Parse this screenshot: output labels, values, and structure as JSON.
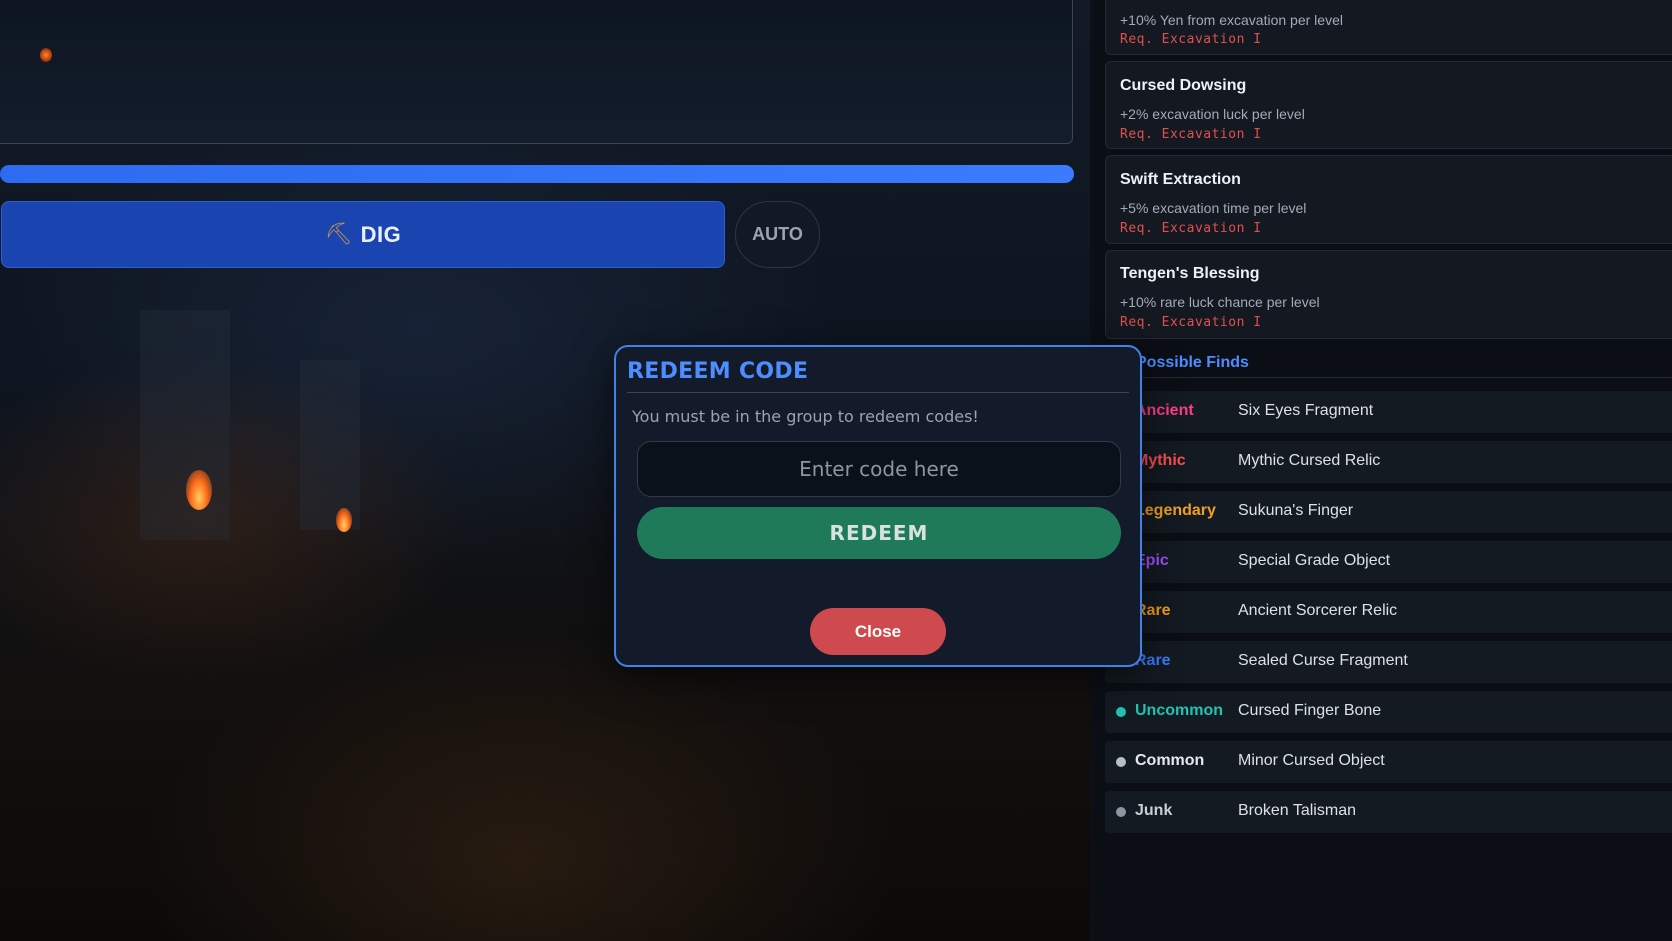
{
  "game": {
    "progress_percent": 100,
    "dig_icon": "pickaxe-icon",
    "dig_label": "DIG",
    "auto_label": "AUTO"
  },
  "upgrades": [
    {
      "name": "",
      "desc": "+10% Yen from excavation per level",
      "req": "Req. Excavation I"
    },
    {
      "name": "Cursed Dowsing",
      "desc": "+2% excavation luck per level",
      "req": "Req. Excavation I"
    },
    {
      "name": "Swift Extraction",
      "desc": "+5% excavation time per level",
      "req": "Req. Excavation I"
    },
    {
      "name": "Tengen's Blessing",
      "desc": "+10% rare luck chance per level",
      "req": "Req. Excavation I"
    }
  ],
  "finds": {
    "title": "Possible Finds",
    "rows": [
      {
        "rarity": "Ancient",
        "item": "Six Eyes Fragment",
        "color": "#ff3d86",
        "dot": ""
      },
      {
        "rarity": "Mythic",
        "item": "Mythic Cursed Relic",
        "color": "#ff4d4f",
        "dot": ""
      },
      {
        "rarity": "Legendary",
        "item": "Sukuna's Finger",
        "color": "#f0a020",
        "dot": ""
      },
      {
        "rarity": "Epic",
        "item": "Special Grade Object",
        "color": "#a64dff",
        "dot": ""
      },
      {
        "rarity": "Rare",
        "item": "Ancient Sorcerer Relic",
        "color": "#f0a020",
        "dot": ""
      },
      {
        "rarity": "Rare",
        "item": "Sealed Curse Fragment",
        "color": "#3d7bff",
        "dot": ""
      },
      {
        "rarity": "Uncommon",
        "item": "Cursed Finger Bone",
        "color": "#20c4b0",
        "dot": "#20c4b0"
      },
      {
        "rarity": "Common",
        "item": "Minor Cursed Object",
        "color": "#e6e8ec",
        "dot": "#b8bec8"
      },
      {
        "rarity": "Junk",
        "item": "Broken Talisman",
        "color": "#c9ced6",
        "dot": "#8d95a3"
      }
    ]
  },
  "modal": {
    "title": "REDEEM CODE",
    "message": "You must be in the group to redeem codes!",
    "input_placeholder": "Enter code here",
    "input_value": "",
    "redeem_label": "REDEEM",
    "close_label": "Close"
  },
  "colors": {
    "accent_blue": "#4d8dff",
    "redeem_green": "#1f7a5a",
    "close_red": "#cf4a4e",
    "req_red": "#e0504e"
  }
}
